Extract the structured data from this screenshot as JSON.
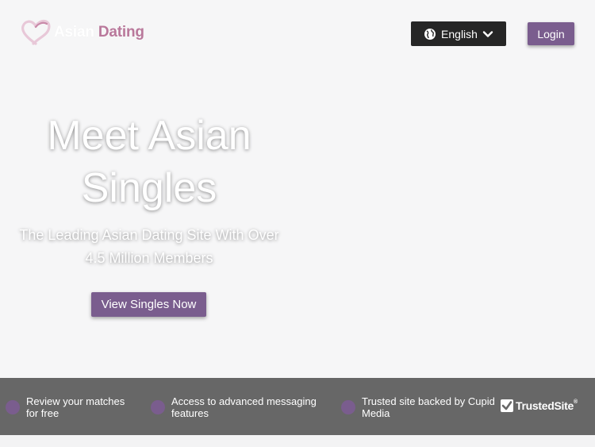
{
  "header": {
    "logo": {
      "word1": "Asian",
      "word2": "Dating",
      "icon": "heart-icon"
    },
    "language": {
      "label": "English",
      "icon": "globe-icon",
      "caret": "chevron-down-icon"
    },
    "login_label": "Login"
  },
  "hero": {
    "title_line1": "Meet Asian",
    "title_line2": "Singles",
    "subtitle_line1": "The Leading Asian Dating Site With Over",
    "subtitle_line2": "4.5 Million Members",
    "cta_label": "View Singles Now"
  },
  "features": [
    {
      "line1": "Review your matches",
      "line2": "for free"
    },
    {
      "line1": "Access to advanced messaging",
      "line2": "features"
    },
    {
      "line1": "Trusted site backed by Cupid",
      "line2": "Media"
    }
  ],
  "trusted_badge": {
    "label": "TrustedSite",
    "reg": "®",
    "icon": "checkbox-check-icon"
  },
  "colors": {
    "accent": "#7a5d8e",
    "logo_pink": "#b9789b",
    "feature_bar": "#676767",
    "lang_bg": "#262626",
    "page_bg": "#f6f6f7"
  }
}
